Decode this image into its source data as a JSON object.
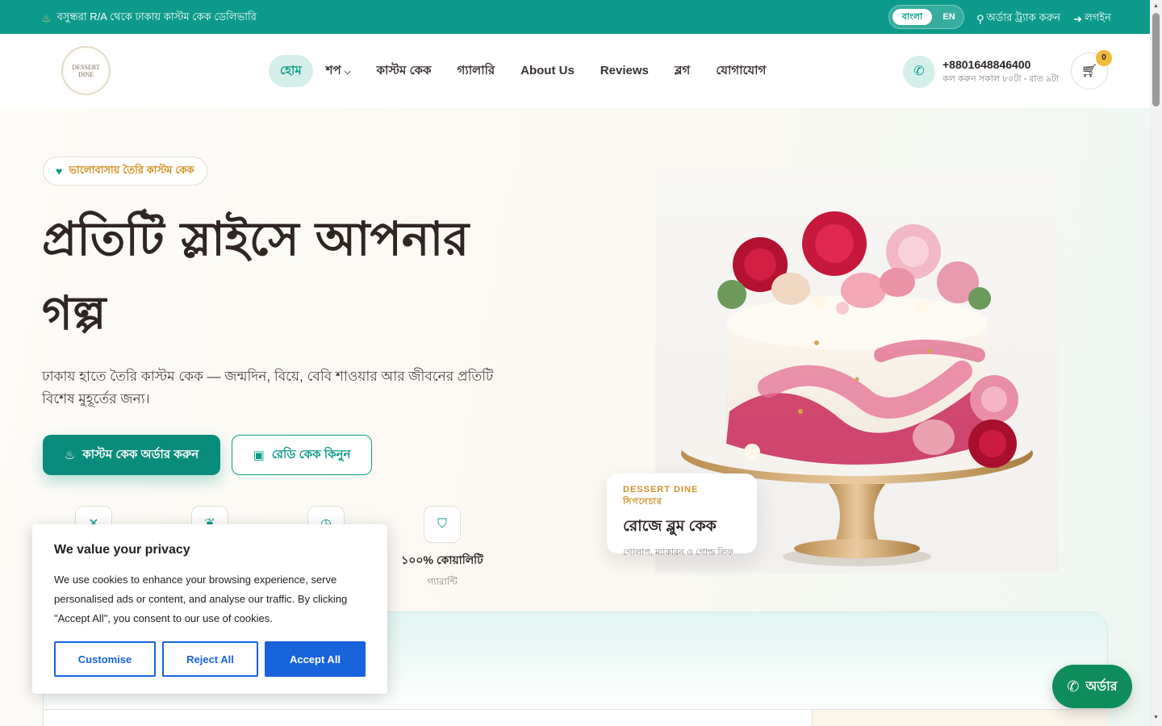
{
  "topbar": {
    "promo": "বসুন্ধরা R/A থেকে ঢাকায় কাস্টম কেক ডেলিভারি",
    "promo_icon": "cake-icon",
    "lang_bn": "বাংলা",
    "lang_en": "EN",
    "track_order": "অর্ডার ট্র্যাক করুন",
    "login": "লগইন",
    "bg_color": "#0c9b8a"
  },
  "header": {
    "logo_line1": "DESSERT",
    "logo_line2": "DINE",
    "nav": [
      {
        "label": "হোম",
        "active": true
      },
      {
        "label": "শপ"
      },
      {
        "label": "কাস্টম কেক"
      },
      {
        "label": "গ্যালারি"
      },
      {
        "label": "About Us"
      },
      {
        "label": "Reviews"
      },
      {
        "label": "ব্লগ"
      },
      {
        "label": "যোগাযোগ"
      }
    ],
    "phone": "+8801648846400",
    "phone_hours": "কল করুন সকাল ৮০টা - রাত ৯টা",
    "cart_count": "0"
  },
  "hero": {
    "pill": "ভালোবাসায় তৈরি কাস্টম কেক",
    "title_line1": "প্রতিটি স্লাইসে আপনার",
    "title_line2": "গল্প",
    "subtitle": "ঢাকায় হাতে তৈরি কাস্টম কেক — জন্মদিন, বিয়ে, বেবি শাওয়ার আর জীবনের প্রতিটি বিশেষ মুহূর্তের জন্য।",
    "primary_button": "কাস্টম কেক অর্ডার করুন",
    "secondary_button": "রেডি কেক কিনুন",
    "features": [
      {
        "icon": "utensils-icon",
        "title": "",
        "sub": ""
      },
      {
        "icon": "leaf-icon",
        "title": "",
        "sub": ""
      },
      {
        "icon": "clock-icon",
        "title": "",
        "sub": ""
      },
      {
        "icon": "shield-icon",
        "title": "১০০% কোয়ালিটি",
        "sub": "গ্যারান্টি"
      }
    ],
    "signature": {
      "kicker": "DESSERT DINE সিগনেচার",
      "title": "রোজে ব্লুম কেক",
      "desc": "গোলাপ, ম্যাকারন ও গোল্ড লিফ"
    },
    "accent_color": "#0c9b8a"
  },
  "cookie": {
    "title": "We value your privacy",
    "body": "We use cookies to enhance your browsing experience, serve personalised ads or content, and analyse our traffic. By clicking \"Accept All\", you consent to our use of cookies.",
    "customise": "Customise",
    "reject": "Reject All",
    "accept": "Accept All",
    "button_color": "#1863dc"
  },
  "whatsapp": {
    "label": "অর্ডার",
    "color": "#0f8c5c"
  }
}
